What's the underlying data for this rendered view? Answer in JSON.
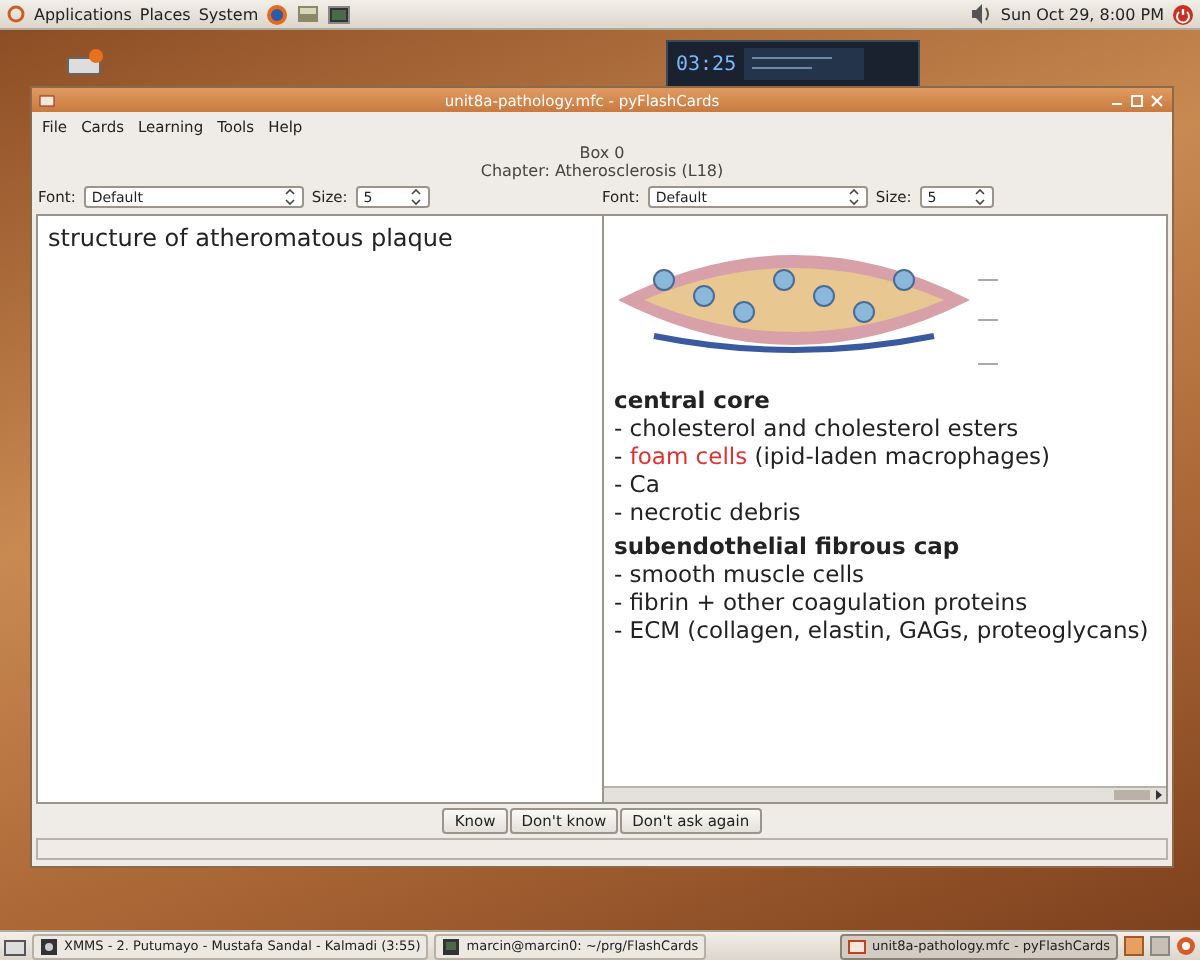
{
  "top_panel": {
    "menus": [
      "Applications",
      "Places",
      "System"
    ],
    "clock": "Sun Oct 29,  8:00 PM"
  },
  "player_widget": {
    "time": "03:25"
  },
  "window": {
    "title": "unit8a-pathology.mfc - pyFlashCards"
  },
  "menu_bar": [
    "File",
    "Cards",
    "Learning",
    "Tools",
    "Help"
  ],
  "box_label": "Box 0",
  "chapter_label": "Chapter: Atherosclerosis (L18)",
  "font_controls": [
    {
      "font_label": "Font:",
      "font": "Default",
      "size_label": "Size:",
      "size": "5"
    },
    {
      "font_label": "Font:",
      "font": "Default",
      "size_label": "Size:",
      "size": "5"
    }
  ],
  "question": "structure of atheromatous plaque",
  "answer_lines": [
    {
      "kind": "heading",
      "parts": [
        {
          "text": "central core",
          "highlight": false
        }
      ]
    },
    {
      "kind": "item",
      "parts": [
        {
          "text": "- cholesterol and cholesterol esters",
          "highlight": false
        }
      ]
    },
    {
      "kind": "item",
      "parts": [
        {
          "text": "- ",
          "highlight": false
        },
        {
          "text": "foam cells",
          "highlight": true
        },
        {
          "text": " (ipid-laden macrophages)",
          "highlight": false
        }
      ]
    },
    {
      "kind": "item",
      "parts": [
        {
          "text": "- Ca",
          "highlight": false
        }
      ]
    },
    {
      "kind": "item",
      "parts": [
        {
          "text": "- necrotic debris",
          "highlight": false
        }
      ]
    },
    {
      "kind": "heading",
      "parts": [
        {
          "text": "subendothelial fibrous cap",
          "highlight": false
        }
      ]
    },
    {
      "kind": "item",
      "parts": [
        {
          "text": "- smooth muscle cells",
          "highlight": false
        }
      ]
    },
    {
      "kind": "item",
      "parts": [
        {
          "text": "- fibrin + other coagulation proteins",
          "highlight": false
        }
      ]
    },
    {
      "kind": "item",
      "parts": [
        {
          "text": "- ECM (collagen, elastin, GAGs, proteoglycans)",
          "highlight": false
        }
      ]
    }
  ],
  "buttons": [
    "Know",
    "Don't know",
    "Don't ask again"
  ],
  "taskbar": [
    {
      "label": "XMMS - 2. Putumayo - Mustafa Sandal - Kalmadi (3:55)",
      "selected": false
    },
    {
      "label": "marcin@marcin0: ~/prg/FlashCards",
      "selected": false
    },
    {
      "label": "unit8a-pathology.mfc - pyFlashCards",
      "selected": true
    }
  ]
}
